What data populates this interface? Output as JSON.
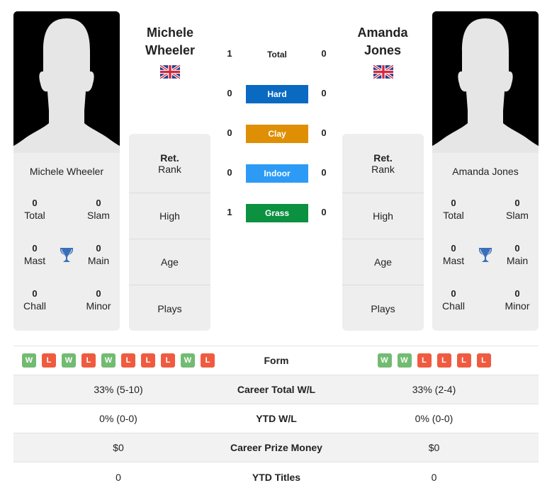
{
  "player1": {
    "name": "Michele Wheeler",
    "name_line1": "Michele",
    "name_line2": "Wheeler",
    "country_flag": "uk-flag-icon",
    "titles": {
      "total": {
        "value": "0",
        "label": "Total"
      },
      "slam": {
        "value": "0",
        "label": "Slam"
      },
      "mast": {
        "value": "0",
        "label": "Mast"
      },
      "main": {
        "value": "0",
        "label": "Main"
      },
      "chall": {
        "value": "0",
        "label": "Chall"
      },
      "minor": {
        "value": "0",
        "label": "Minor"
      }
    },
    "info": {
      "rank_top": "Ret.",
      "rank_label": "Rank",
      "high": "High",
      "age": "Age",
      "plays": "Plays"
    }
  },
  "player2": {
    "name": "Amanda Jones",
    "name_line1": "Amanda",
    "name_line2": "Jones",
    "country_flag": "uk-flag-icon",
    "titles": {
      "total": {
        "value": "0",
        "label": "Total"
      },
      "slam": {
        "value": "0",
        "label": "Slam"
      },
      "mast": {
        "value": "0",
        "label": "Mast"
      },
      "main": {
        "value": "0",
        "label": "Main"
      },
      "chall": {
        "value": "0",
        "label": "Chall"
      },
      "minor": {
        "value": "0",
        "label": "Minor"
      }
    },
    "info": {
      "rank_top": "Ret.",
      "rank_label": "Rank",
      "high": "High",
      "age": "Age",
      "plays": "Plays"
    }
  },
  "h2h": [
    {
      "label": "Total",
      "left": "1",
      "right": "0",
      "color": ""
    },
    {
      "label": "Hard",
      "left": "0",
      "right": "0",
      "color": "#0a6ac2"
    },
    {
      "label": "Clay",
      "left": "0",
      "right": "0",
      "color": "#de8f04"
    },
    {
      "label": "Indoor",
      "left": "0",
      "right": "0",
      "color": "#2d9bf5"
    },
    {
      "label": "Grass",
      "left": "1",
      "right": "0",
      "color": "#0b9140"
    }
  ],
  "comparison": {
    "form_label": "Form",
    "form_left": [
      "W",
      "L",
      "W",
      "L",
      "W",
      "L",
      "L",
      "L",
      "W",
      "L"
    ],
    "form_right": [
      "W",
      "W",
      "L",
      "L",
      "L",
      "L"
    ],
    "rows": [
      {
        "label": "Career Total W/L",
        "left": "33% (5-10)",
        "right": "33% (2-4)"
      },
      {
        "label": "YTD W/L",
        "left": "0% (0-0)",
        "right": "0% (0-0)"
      },
      {
        "label": "Career Prize Money",
        "left": "$0",
        "right": "$0"
      },
      {
        "label": "YTD Titles",
        "left": "0",
        "right": "0"
      }
    ]
  },
  "colors": {
    "win": "#72bb72",
    "loss": "#ef5b40",
    "trophy": "#3a6fb8"
  }
}
